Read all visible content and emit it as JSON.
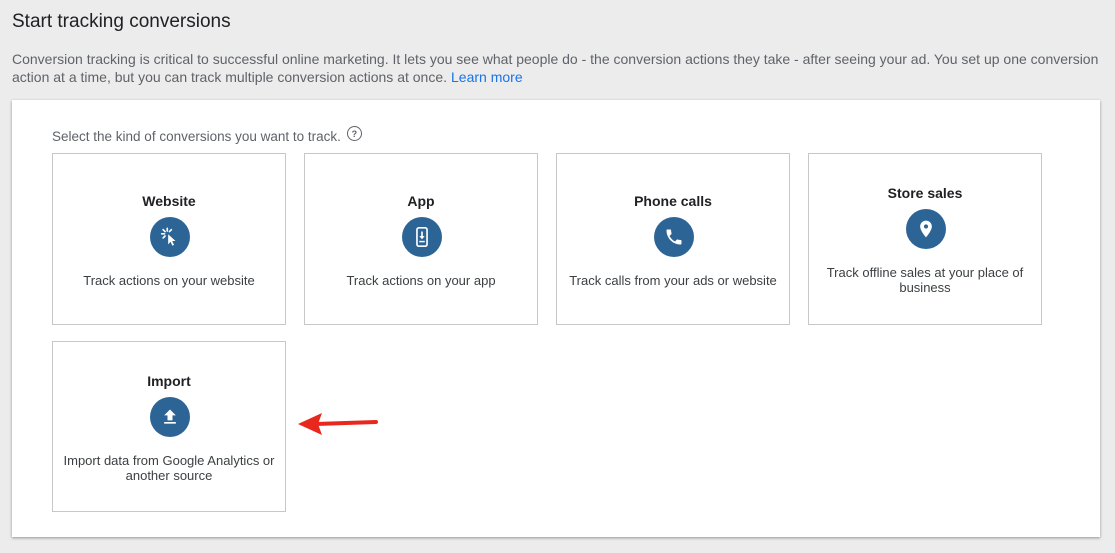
{
  "header": {
    "title": "Start tracking conversions",
    "intro_text": "Conversion tracking is critical to successful online marketing. It lets you see what people do - the conversion actions they take - after seeing your ad. You set up one conversion action at a time, but you can track multiple conversion actions at once.",
    "learn_more_label": "Learn more"
  },
  "panel": {
    "select_label": "Select the kind of conversions you want to track.",
    "help_icon_glyph": "?",
    "cards": [
      {
        "title": "Website",
        "icon": "cursor-click-icon",
        "description": "Track actions on your website"
      },
      {
        "title": "App",
        "icon": "smartphone-download-icon",
        "description": "Track actions on your app"
      },
      {
        "title": "Phone calls",
        "icon": "phone-icon",
        "description": "Track calls from your ads or website"
      },
      {
        "title": "Store sales",
        "icon": "location-pin-icon",
        "description": "Track offline sales at your place of business"
      },
      {
        "title": "Import",
        "icon": "upload-icon",
        "description": "Import data from Google Analytics or another source"
      }
    ]
  },
  "colors": {
    "accent": "#1a73e8",
    "icon_circle": "#2c6496",
    "annotation_arrow": "#e8271d"
  }
}
